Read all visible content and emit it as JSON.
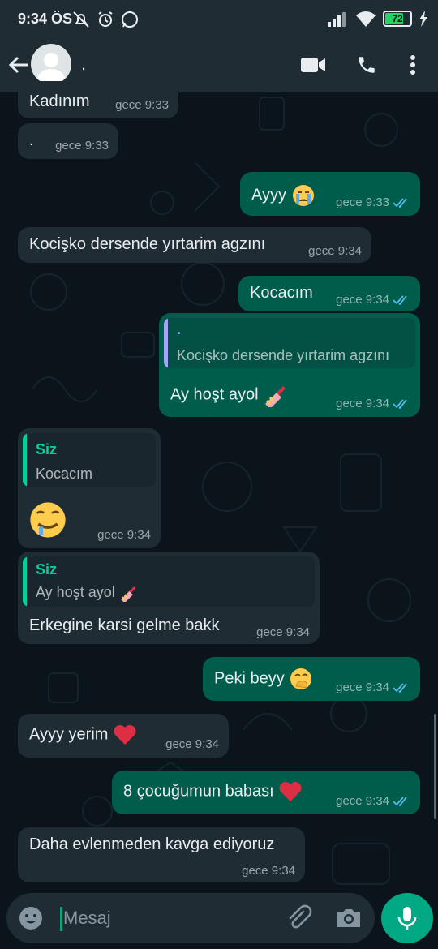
{
  "status_bar": {
    "time": "9:34 ÖS",
    "battery": "72",
    "battery_level": 0.72,
    "icons": [
      "muted-bell-icon",
      "alarm-icon",
      "whatsapp-icon",
      "signal-icon",
      "wifi-icon",
      "battery-icon",
      "charging-icon"
    ]
  },
  "header": {
    "contact_name": ".",
    "icons": [
      "back-arrow-icon",
      "avatar-icon",
      "video-call-icon",
      "phone-icon",
      "more-vert-icon"
    ]
  },
  "messages": [
    {
      "dir": "in",
      "text": "Kadınım",
      "time": "gece 9:33"
    },
    {
      "dir": "in",
      "text": ".",
      "time": "gece 9:33"
    },
    {
      "dir": "out",
      "text": "Ayyy",
      "emoji": "crying-face",
      "time": "gece 9:33",
      "read": true
    },
    {
      "dir": "in",
      "text": "Kocişko dersende yırtarim agzını",
      "time": "gece 9:34"
    },
    {
      "dir": "out",
      "text": "Kocacım",
      "time": "gece 9:34",
      "read": true
    },
    {
      "dir": "out",
      "quote_name": ".",
      "quote_text": "Kocişko dersende yırtarim agzını",
      "text": "Ay hoşt ayol",
      "emoji": "nail-polish",
      "time": "gece 9:34",
      "read": true
    },
    {
      "dir": "in",
      "quote_name": "Siz",
      "quote_text": "Kocacım",
      "text": "",
      "emoji": "drooling-face",
      "time": "gece 9:34"
    },
    {
      "dir": "in",
      "quote_name": "Siz",
      "quote_text": "Ay hoşt ayol",
      "quote_emoji": "nail-polish",
      "text": "Erkegine karsi gelme bakk",
      "time": "gece 9:34"
    },
    {
      "dir": "out",
      "text": "Peki beyy",
      "emoji": "face-with-hand-over-mouth",
      "time": "gece 9:34",
      "read": true
    },
    {
      "dir": "in",
      "text": "Ayyy yerim",
      "emoji": "red-heart",
      "time": "gece 9:34"
    },
    {
      "dir": "out",
      "text": "8 çocuğumun babası",
      "emoji": "red-heart",
      "time": "gece 9:34",
      "read": true
    },
    {
      "dir": "in",
      "text": "Daha evlenmeden kavga ediyoruz",
      "time": "gece 9:34"
    }
  ],
  "input": {
    "placeholder": "Mesaj",
    "icons": [
      "emoji-icon",
      "attach-icon",
      "camera-icon",
      "mic-icon"
    ]
  },
  "colors": {
    "background": "#0b141a",
    "header": "#1f2c34",
    "incoming_bubble": "#1f2c34",
    "outgoing_bubble": "#005c4b",
    "accent": "#00a884",
    "read_ticks": "#53bdeb",
    "quote_bar_self": "#06cf9c",
    "quote_bar_other": "#a5a5f8"
  }
}
